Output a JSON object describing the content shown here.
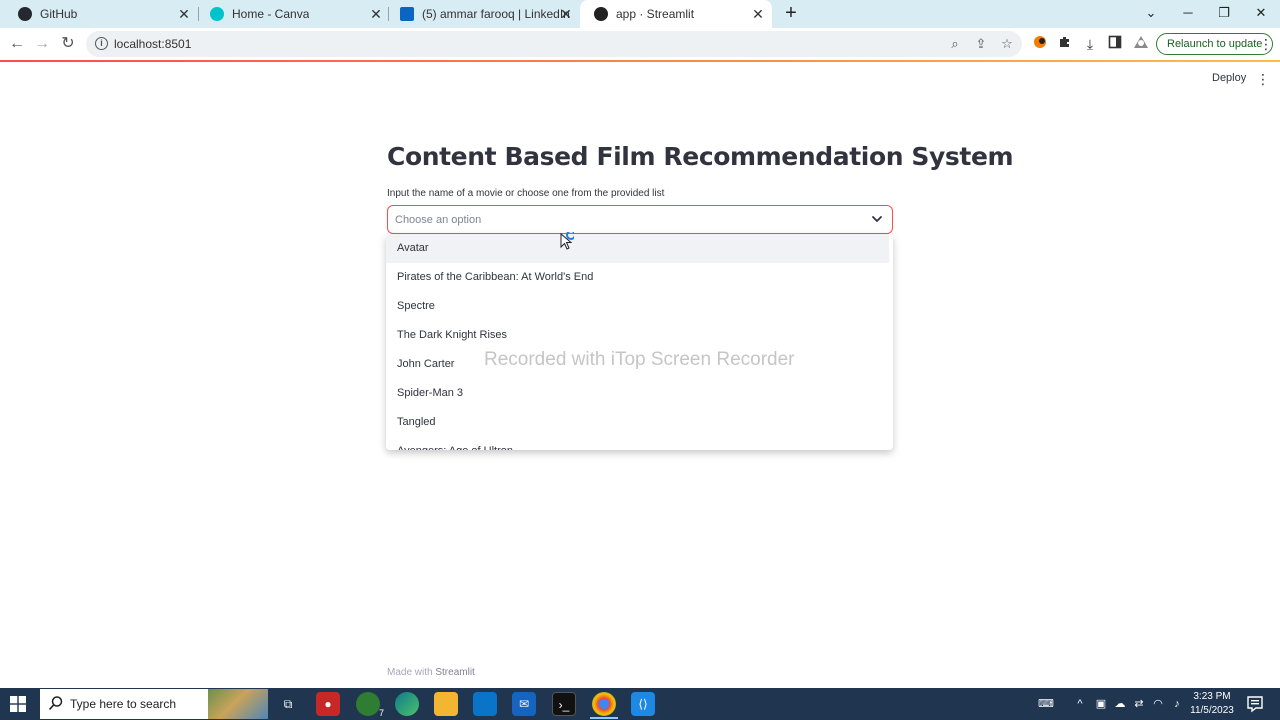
{
  "browser": {
    "tabs": [
      {
        "title": "GitHub",
        "favicon_color": "#24292f"
      },
      {
        "title": "Home - Canva",
        "favicon_color": "#00c4cc"
      },
      {
        "title": "(5) ammar farooq | LinkedIn",
        "favicon_color": "#0a66c2"
      },
      {
        "title": "app · Streamlit",
        "favicon_color": "#222222"
      }
    ],
    "url": "localhost:8501",
    "relaunch_label": "Relaunch to update"
  },
  "app": {
    "deploy_label": "Deploy",
    "title": "Content Based Film Recommendation System",
    "select": {
      "label": "Input the name of a movie or choose one from the provided list",
      "placeholder": "Choose an option",
      "options": [
        "Avatar",
        "Pirates of the Caribbean: At World's End",
        "Spectre",
        "The Dark Knight Rises",
        "John Carter",
        "Spider-Man 3",
        "Tangled",
        "Avengers: Age of Ultron"
      ]
    },
    "footer_prefix": "Made with",
    "footer_brand": "Streamlit",
    "accent_color": "#ff4b4b"
  },
  "overlay": {
    "watermark": "Recorded with iTop Screen Recorder"
  },
  "taskbar": {
    "search_placeholder": "Type here to search",
    "time": "3:23 PM",
    "date": "11/5/2023",
    "whatsapp_badge": "7"
  }
}
